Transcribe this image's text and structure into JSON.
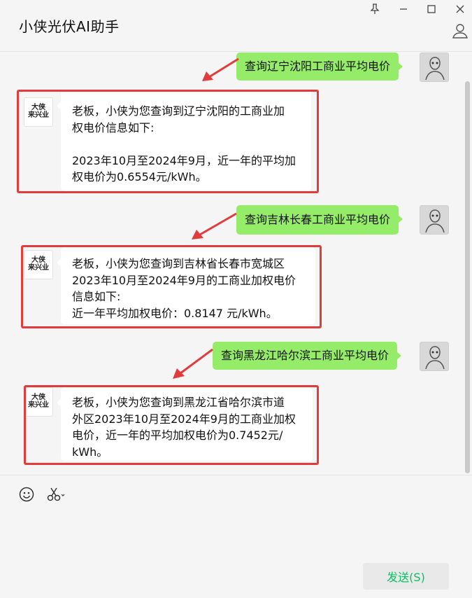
{
  "window": {
    "title": "小侠光伏AI助手"
  },
  "colors": {
    "user_bubble": "#95ec69",
    "bot_bubble": "#ffffff",
    "highlight": "#e23b3b",
    "send_text": "#07c160",
    "background": "#f5f5f5"
  },
  "messages": [
    {
      "role": "user",
      "text": "查询辽宁沈阳工商业平均电价"
    },
    {
      "role": "bot",
      "text": "老板，小侠为您查询到辽宁沈阳的工商业加\n权电价信息如下:\n\n2023年10月至2024年9月，近一年的平均加\n权电价为0.6554元/kWh。"
    },
    {
      "role": "user",
      "text": "查询吉林长春工商业平均电价"
    },
    {
      "role": "bot",
      "text": "老板，小侠为您查询到吉林省长春市宽城区\n2023年10月至2024年9月的工商业加权电价\n信息如下:\n近一年平均加权电价：0.8147 元/kWh。"
    },
    {
      "role": "user",
      "text": "查询黑龙江哈尔滨工商业平均电价"
    },
    {
      "role": "bot",
      "text": "老板，小侠为您查询到黑龙江省哈尔滨市道\n外区2023年10月至2024年9月的工商业加权\n电价，近一年的平均加权电价为0.7452元/\nkWh。"
    }
  ],
  "bot_avatar": {
    "logo_text": "大侠\n来兴业"
  },
  "icons": {
    "pin": "pin-icon",
    "minimize": "minimize-icon",
    "maximize": "maximize-icon",
    "close": "close-icon",
    "profile": "person-icon",
    "emoji": "emoji-icon",
    "screenshot": "scissors-icon"
  },
  "composer": {
    "value": "",
    "send_label": "发送(S)"
  }
}
